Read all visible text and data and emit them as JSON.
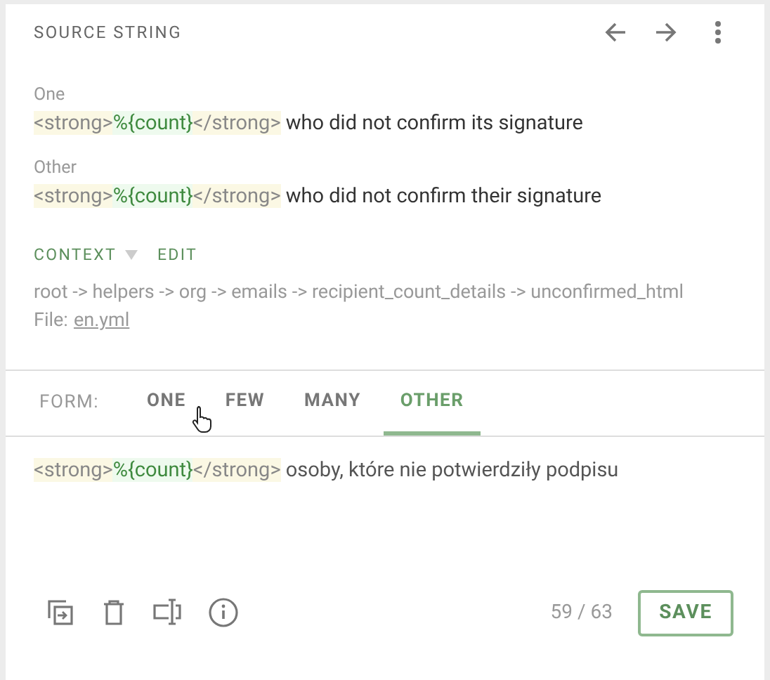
{
  "header": {
    "title": "SOURCE STRING"
  },
  "source_forms": [
    {
      "label": "One",
      "segments": [
        {
          "kind": "tag",
          "text": "<strong>"
        },
        {
          "kind": "placeable",
          "text": "%{count}"
        },
        {
          "kind": "tag",
          "text": "</strong>"
        },
        {
          "kind": "text",
          "text": " who did not confirm its signature"
        }
      ]
    },
    {
      "label": "Other",
      "segments": [
        {
          "kind": "tag",
          "text": "<strong>"
        },
        {
          "kind": "placeable",
          "text": "%{count}"
        },
        {
          "kind": "tag",
          "text": "</strong>"
        },
        {
          "kind": "text",
          "text": " who did not confirm their signature"
        }
      ]
    }
  ],
  "context": {
    "toggle": "CONTEXT",
    "edit": "EDIT",
    "path": "root -> helpers -> org -> emails -> recipient_count_details -> unconfirmed_html",
    "file_label": "File:",
    "file": "en.yml"
  },
  "form_tabs": {
    "label": "FORM:",
    "tabs": [
      {
        "label": "ONE",
        "selected": false
      },
      {
        "label": "FEW",
        "selected": false
      },
      {
        "label": "MANY",
        "selected": false
      },
      {
        "label": "OTHER",
        "selected": true
      }
    ]
  },
  "translation": {
    "segments": [
      {
        "kind": "tag",
        "text": "<strong>"
      },
      {
        "kind": "placeable",
        "text": "%{count}"
      },
      {
        "kind": "tag",
        "text": "</strong>"
      },
      {
        "kind": "text",
        "text": " osoby, które nie potwierdziły podpisu"
      }
    ]
  },
  "footer": {
    "counter": "59 / 63",
    "save": "SAVE"
  }
}
